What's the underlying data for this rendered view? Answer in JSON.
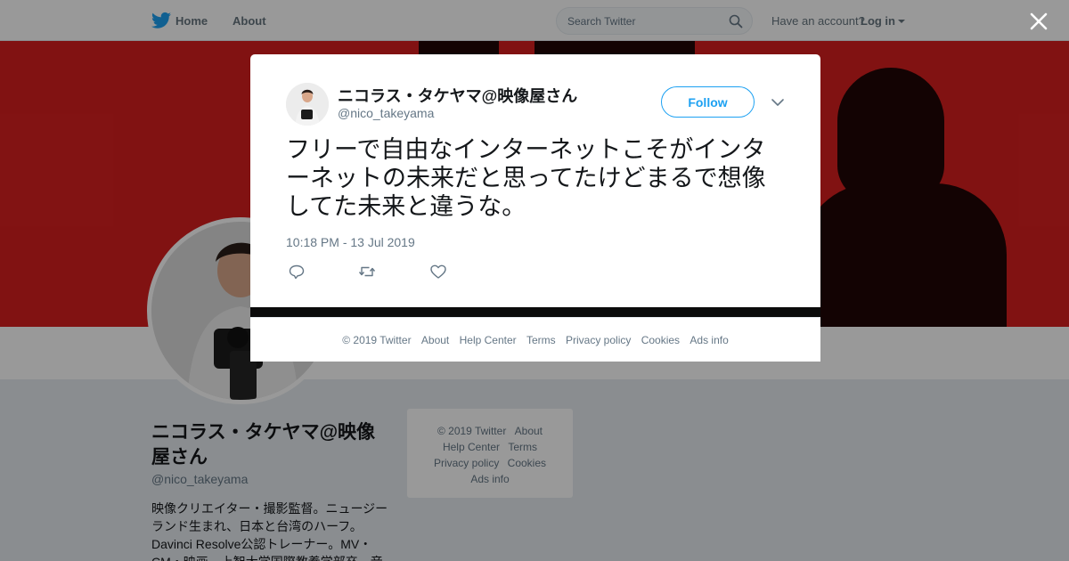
{
  "nav": {
    "logo_icon": "twitter-bird-icon",
    "home": "Home",
    "about": "About",
    "search_placeholder": "Search Twitter",
    "account_prompt": "Have an account?",
    "login": "Log in",
    "accent": "#1da1f2"
  },
  "profile": {
    "name": "ニコラス・タケヤマ@映像屋さん",
    "handle": "@nico_takeyama",
    "bio": "映像クリエイター・撮影監督。ニュージーランド生まれ、日本と台湾のハーフ。Davinci Resolve公認トレーナー。MV・CM・映画。上智大学国際教養学部卒。音"
  },
  "sidebar_footer": {
    "items": [
      "© 2019 Twitter",
      "About",
      "Help Center",
      "Terms",
      "Privacy policy",
      "Cookies",
      "Ads info"
    ]
  },
  "tweet": {
    "name": "ニコラス・タケヤマ@映像屋さん",
    "handle": "@nico_takeyama",
    "follow": "Follow",
    "text": "フリーで自由なインターネットこそがインターネットの未来だと思ってたけどまるで想像してた未来と違うな。",
    "timestamp": "10:18 PM - 13 Jul 2019",
    "actions": [
      "reply-icon",
      "retweet-icon",
      "like-icon"
    ]
  },
  "modal_footer": {
    "items": [
      "© 2019 Twitter",
      "About",
      "Help Center",
      "Terms",
      "Privacy policy",
      "Cookies",
      "Ads info"
    ]
  }
}
